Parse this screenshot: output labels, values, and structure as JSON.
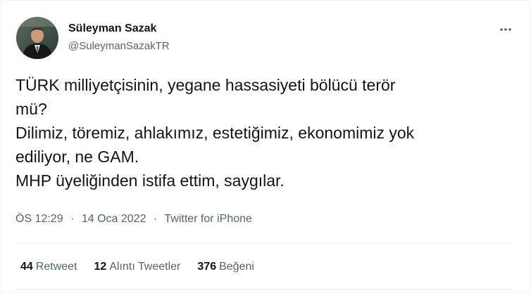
{
  "author": {
    "name": "Süleyman Sazak",
    "handle": "@SuleymanSazakTR"
  },
  "tweet": {
    "lines": [
      "TÜRK milliyetçisinin, yegane hassasiyeti bölücü terör",
      "mü?",
      "Dilimiz, töremiz, ahlakımız, estetiğimiz, ekonomimiz yok",
      "ediliyor, ne GAM.",
      "MHP üyeliğinden istifa ettim, saygılar."
    ]
  },
  "meta": {
    "time": "ÖS 12:29",
    "separator1": "·",
    "date": "14 Oca 2022",
    "separator2": "·",
    "source": "Twitter for iPhone"
  },
  "stats": {
    "retweets": {
      "count": "44",
      "label": "Retweet"
    },
    "quotes": {
      "count": "12",
      "label": "Alıntı Tweetler"
    },
    "likes": {
      "count": "376",
      "label": "Beğeni"
    }
  },
  "icons": {
    "more": "more-horizontal-icon",
    "avatar": "profile-avatar"
  },
  "colors": {
    "text": "#0f1419",
    "secondary": "#536471",
    "border": "#eff3f4"
  }
}
